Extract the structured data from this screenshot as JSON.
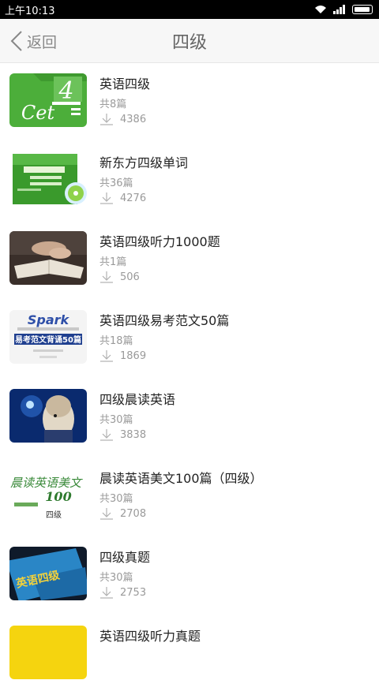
{
  "status_bar": {
    "time": "上午10:13"
  },
  "nav": {
    "back_label": "返回",
    "title": "四级"
  },
  "items": [
    {
      "title": "英语四级",
      "count": "共8篇",
      "downloads": "4386"
    },
    {
      "title": "新东方四级单词",
      "count": "共36篇",
      "downloads": "4276"
    },
    {
      "title": "英语四级听力1000题",
      "count": "共1篇",
      "downloads": "506"
    },
    {
      "title": "英语四级易考范文50篇",
      "count": "共18篇",
      "downloads": "1869"
    },
    {
      "title": "四级晨读英语",
      "count": "共30篇",
      "downloads": "3838"
    },
    {
      "title": "晨读英语美文100篇（四级）",
      "count": "共30篇",
      "downloads": "2708"
    },
    {
      "title": "四级真题",
      "count": "共30篇",
      "downloads": "2753"
    },
    {
      "title": "英语四级听力真题",
      "count": "",
      "downloads": ""
    }
  ],
  "covers": {
    "cet4_number": "4",
    "cet4_text": "Cet",
    "spark_text": "Spark",
    "spark_banner": "易考范文背诵50篇",
    "chendu_text": "晨读英语美文",
    "chendu_num": "100",
    "chendu_level": "四级",
    "zhenti_text": "英语四级"
  },
  "colors": {
    "accent_green": "#4cae3a",
    "nav_bg": "#f7f7f7",
    "text_gray": "#9a9a9a"
  }
}
